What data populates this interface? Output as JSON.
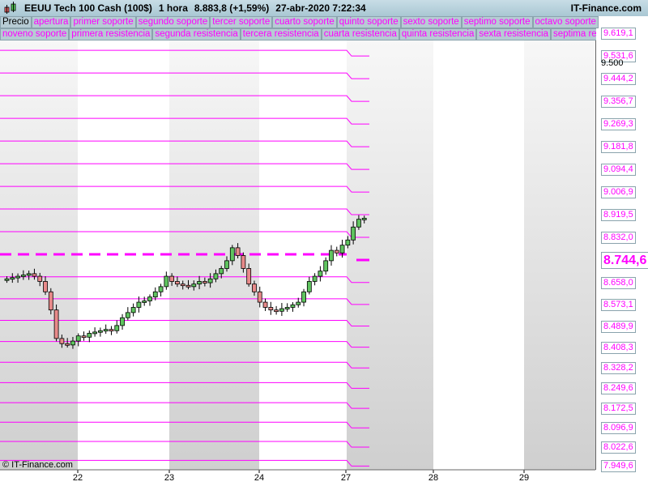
{
  "header": {
    "instrument": "EEUU Tech 100 Cash (100$)",
    "timeframe": "1 hora",
    "last": "8.883,8 (+1,59%)",
    "datetime": "27-abr-2020 7:22:34",
    "brand": "IT-Finance.com"
  },
  "legend_row1": [
    "Precio",
    "apertura",
    "primer soporte",
    "segundo soporte",
    "tercer soporte",
    "cuarto soporte",
    "quinto soporte",
    "sexto soporte",
    "septimo soporte",
    "octavo soporte"
  ],
  "legend_row2": [
    "noveno soporte",
    "primera resistencia",
    "segunda resistencia",
    "tercera resistencia",
    "cuarta resistencia",
    "quinta resistencia",
    "sexta resistencia",
    "septima resistencia"
  ],
  "copyright": "© IT-Finance.com",
  "chart_data": {
    "type": "candlestick",
    "title": "EEUU Tech 100 Cash (100$) 1 hora",
    "levels": [
      9619.1,
      9531.6,
      9444.2,
      9356.7,
      9269.3,
      9181.8,
      9094.4,
      9006.9,
      8919.5,
      8832.0,
      8744.6,
      8658.0,
      8573.1,
      8489.9,
      8408.3,
      8328.2,
      8249.6,
      8172.5,
      8096.9,
      8022.6,
      7949.6
    ],
    "level_labels": [
      "9.619,1",
      "9.531,6",
      "9.444,2",
      "9.356,7",
      "9.269,3",
      "9.181,8",
      "9.094,4",
      "9.006,9",
      "8.919,5",
      "8.832,0",
      "8.744,6",
      "8.658,0",
      "8.573,1",
      "8.489,9",
      "8.408,3",
      "8.328,2",
      "8.249,6",
      "8.172,5",
      "8.096,9",
      "8.022,6",
      "7.949,6"
    ],
    "open_level": 8744.6,
    "axis_tick": "9.500",
    "x_ticks": [
      "22",
      "23",
      "24",
      "27",
      "28",
      "29"
    ],
    "closes": [
      8650,
      8655,
      8660,
      8665,
      8670,
      8660,
      8640,
      8600,
      8530,
      8420,
      8400,
      8395,
      8410,
      8430,
      8425,
      8440,
      8445,
      8450,
      8455,
      8450,
      8470,
      8500,
      8520,
      8540,
      8560,
      8565,
      8580,
      8600,
      8620,
      8660,
      8640,
      8630,
      8625,
      8620,
      8630,
      8640,
      8635,
      8650,
      8670,
      8690,
      8720,
      8770,
      8740,
      8690,
      8630,
      8600,
      8560,
      8540,
      8530,
      8525,
      8535,
      8540,
      8550,
      8560,
      8600,
      8640,
      8660,
      8680,
      8720,
      8760,
      8750,
      8780,
      8800,
      8850,
      8880,
      8884
    ],
    "colors": {
      "level": "#ff00ff",
      "up": "#5fc45f",
      "down": "#e88a8a"
    }
  }
}
